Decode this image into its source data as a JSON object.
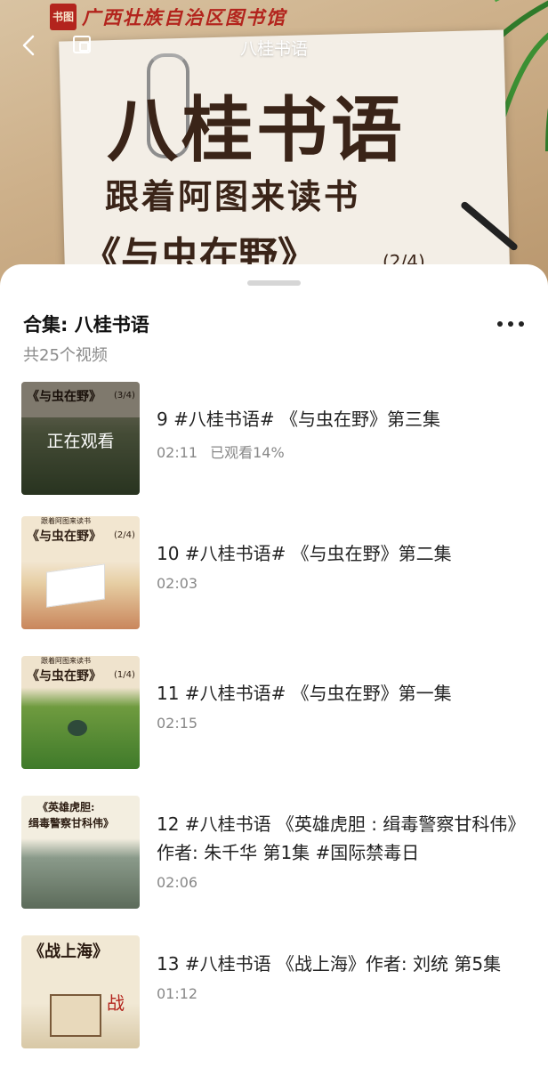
{
  "hero": {
    "stamp": "书图",
    "org": "广西壮族自治区图书馆",
    "title_main": "八桂书语",
    "subtitle": "跟着阿图来读书",
    "book_title": "《与虫在野》",
    "book_part": "(2/4)"
  },
  "topbar": {
    "title": "八桂书语"
  },
  "sheet": {
    "title": "合集: 八桂书语",
    "count": "共25个视频"
  },
  "items": [
    {
      "title": "9  #八桂书语# 《与虫在野》第三集",
      "duration": "02:11",
      "watched": "已观看14%",
      "overlay": "正在观看",
      "thumb_title": "《与虫在野》",
      "thumb_part": "(3/4)"
    },
    {
      "title": "10  #八桂书语# 《与虫在野》第二集",
      "duration": "02:03",
      "thumb_top": "跟着阿图来读书",
      "thumb_title": "《与虫在野》",
      "thumb_part": "(2/4)"
    },
    {
      "title": "11  #八桂书语# 《与虫在野》第一集",
      "duration": "02:15",
      "thumb_top": "跟着阿图来读书",
      "thumb_title": "《与虫在野》",
      "thumb_part": "(1/4)"
    },
    {
      "title": "12  #八桂书语 《英雄虎胆 : 缉毒警察甘科伟》作者:  朱千华 第1集 #国际禁毒日",
      "duration": "02:06",
      "thumb_title": "《英雄虎胆:",
      "thumb_title2": "缉毒警察甘科伟》"
    },
    {
      "title": "13  #八桂书语 《战上海》作者:  刘统 第5集",
      "duration": "01:12",
      "thumb_title": "《战上海》"
    }
  ]
}
